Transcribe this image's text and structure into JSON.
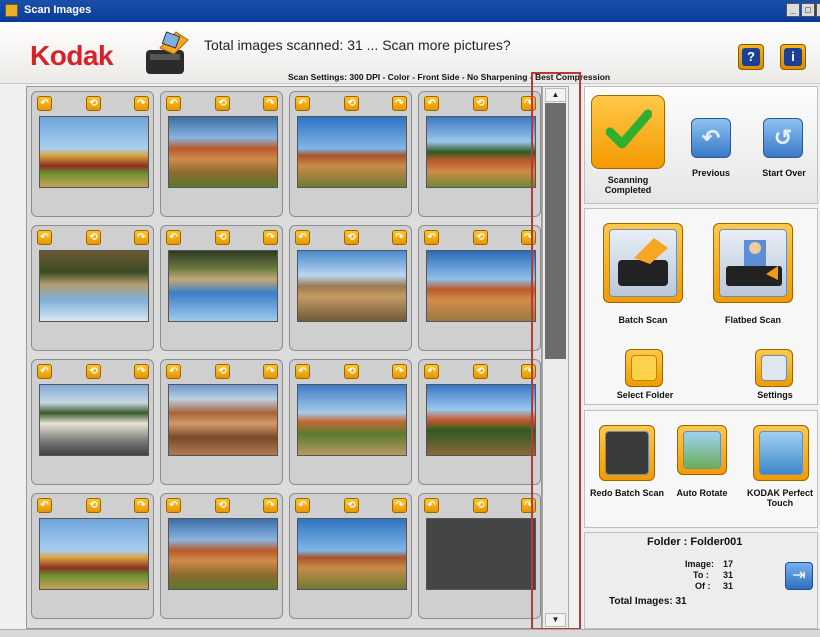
{
  "window": {
    "title": "Scan Images",
    "min": "_",
    "max": "□",
    "close": "x"
  },
  "header": {
    "logo": "Kodak",
    "headline": "Total images scanned: 31 ... Scan more pictures?",
    "settings": "Scan Settings: 300 DPI - Color - Front Side - No Sharpening - Best Compression",
    "help_label": "?",
    "info_label": "i"
  },
  "thumbnails": [
    {
      "scene": "barn"
    },
    {
      "scene": "desert-plateau"
    },
    {
      "scene": "mesa"
    },
    {
      "scene": "red-rock"
    },
    {
      "scene": "upside-down-forest"
    },
    {
      "scene": "upside-down-canyon"
    },
    {
      "scene": "canyon"
    },
    {
      "scene": "red-butte"
    },
    {
      "scene": "street-houses"
    },
    {
      "scene": "grand-canyon"
    },
    {
      "scene": "sedona-valley"
    },
    {
      "scene": "red-rock-2"
    },
    {
      "scene": "barn"
    },
    {
      "scene": "desert-plateau"
    },
    {
      "scene": "mesa"
    },
    {
      "scene": "empty"
    }
  ],
  "rotate_icons": {
    "left": "↶",
    "flip": "⟲",
    "right": "↷"
  },
  "controls": {
    "scanning_completed": "Scanning Completed",
    "previous": "Previous",
    "start_over": "Start Over",
    "batch_scan": "Batch Scan",
    "flatbed_scan": "Flatbed Scan",
    "select_folder": "Select Folder",
    "settings": "Settings",
    "redo_batch_scan": "Redo Batch Scan",
    "auto_rotate": "Auto Rotate",
    "perfect_touch": "KODAK Perfect Touch"
  },
  "info": {
    "folder": "Folder : Folder001",
    "image_label": "Image:",
    "image_value": "17",
    "to_label": "To :",
    "to_value": "31",
    "of_label": "Of :",
    "of_value": "31",
    "total": "Total Images: 31"
  },
  "colors": {
    "kodak_red": "#d42329",
    "accent_yellow": "#f59a00",
    "accent_blue": "#3a78c8"
  }
}
